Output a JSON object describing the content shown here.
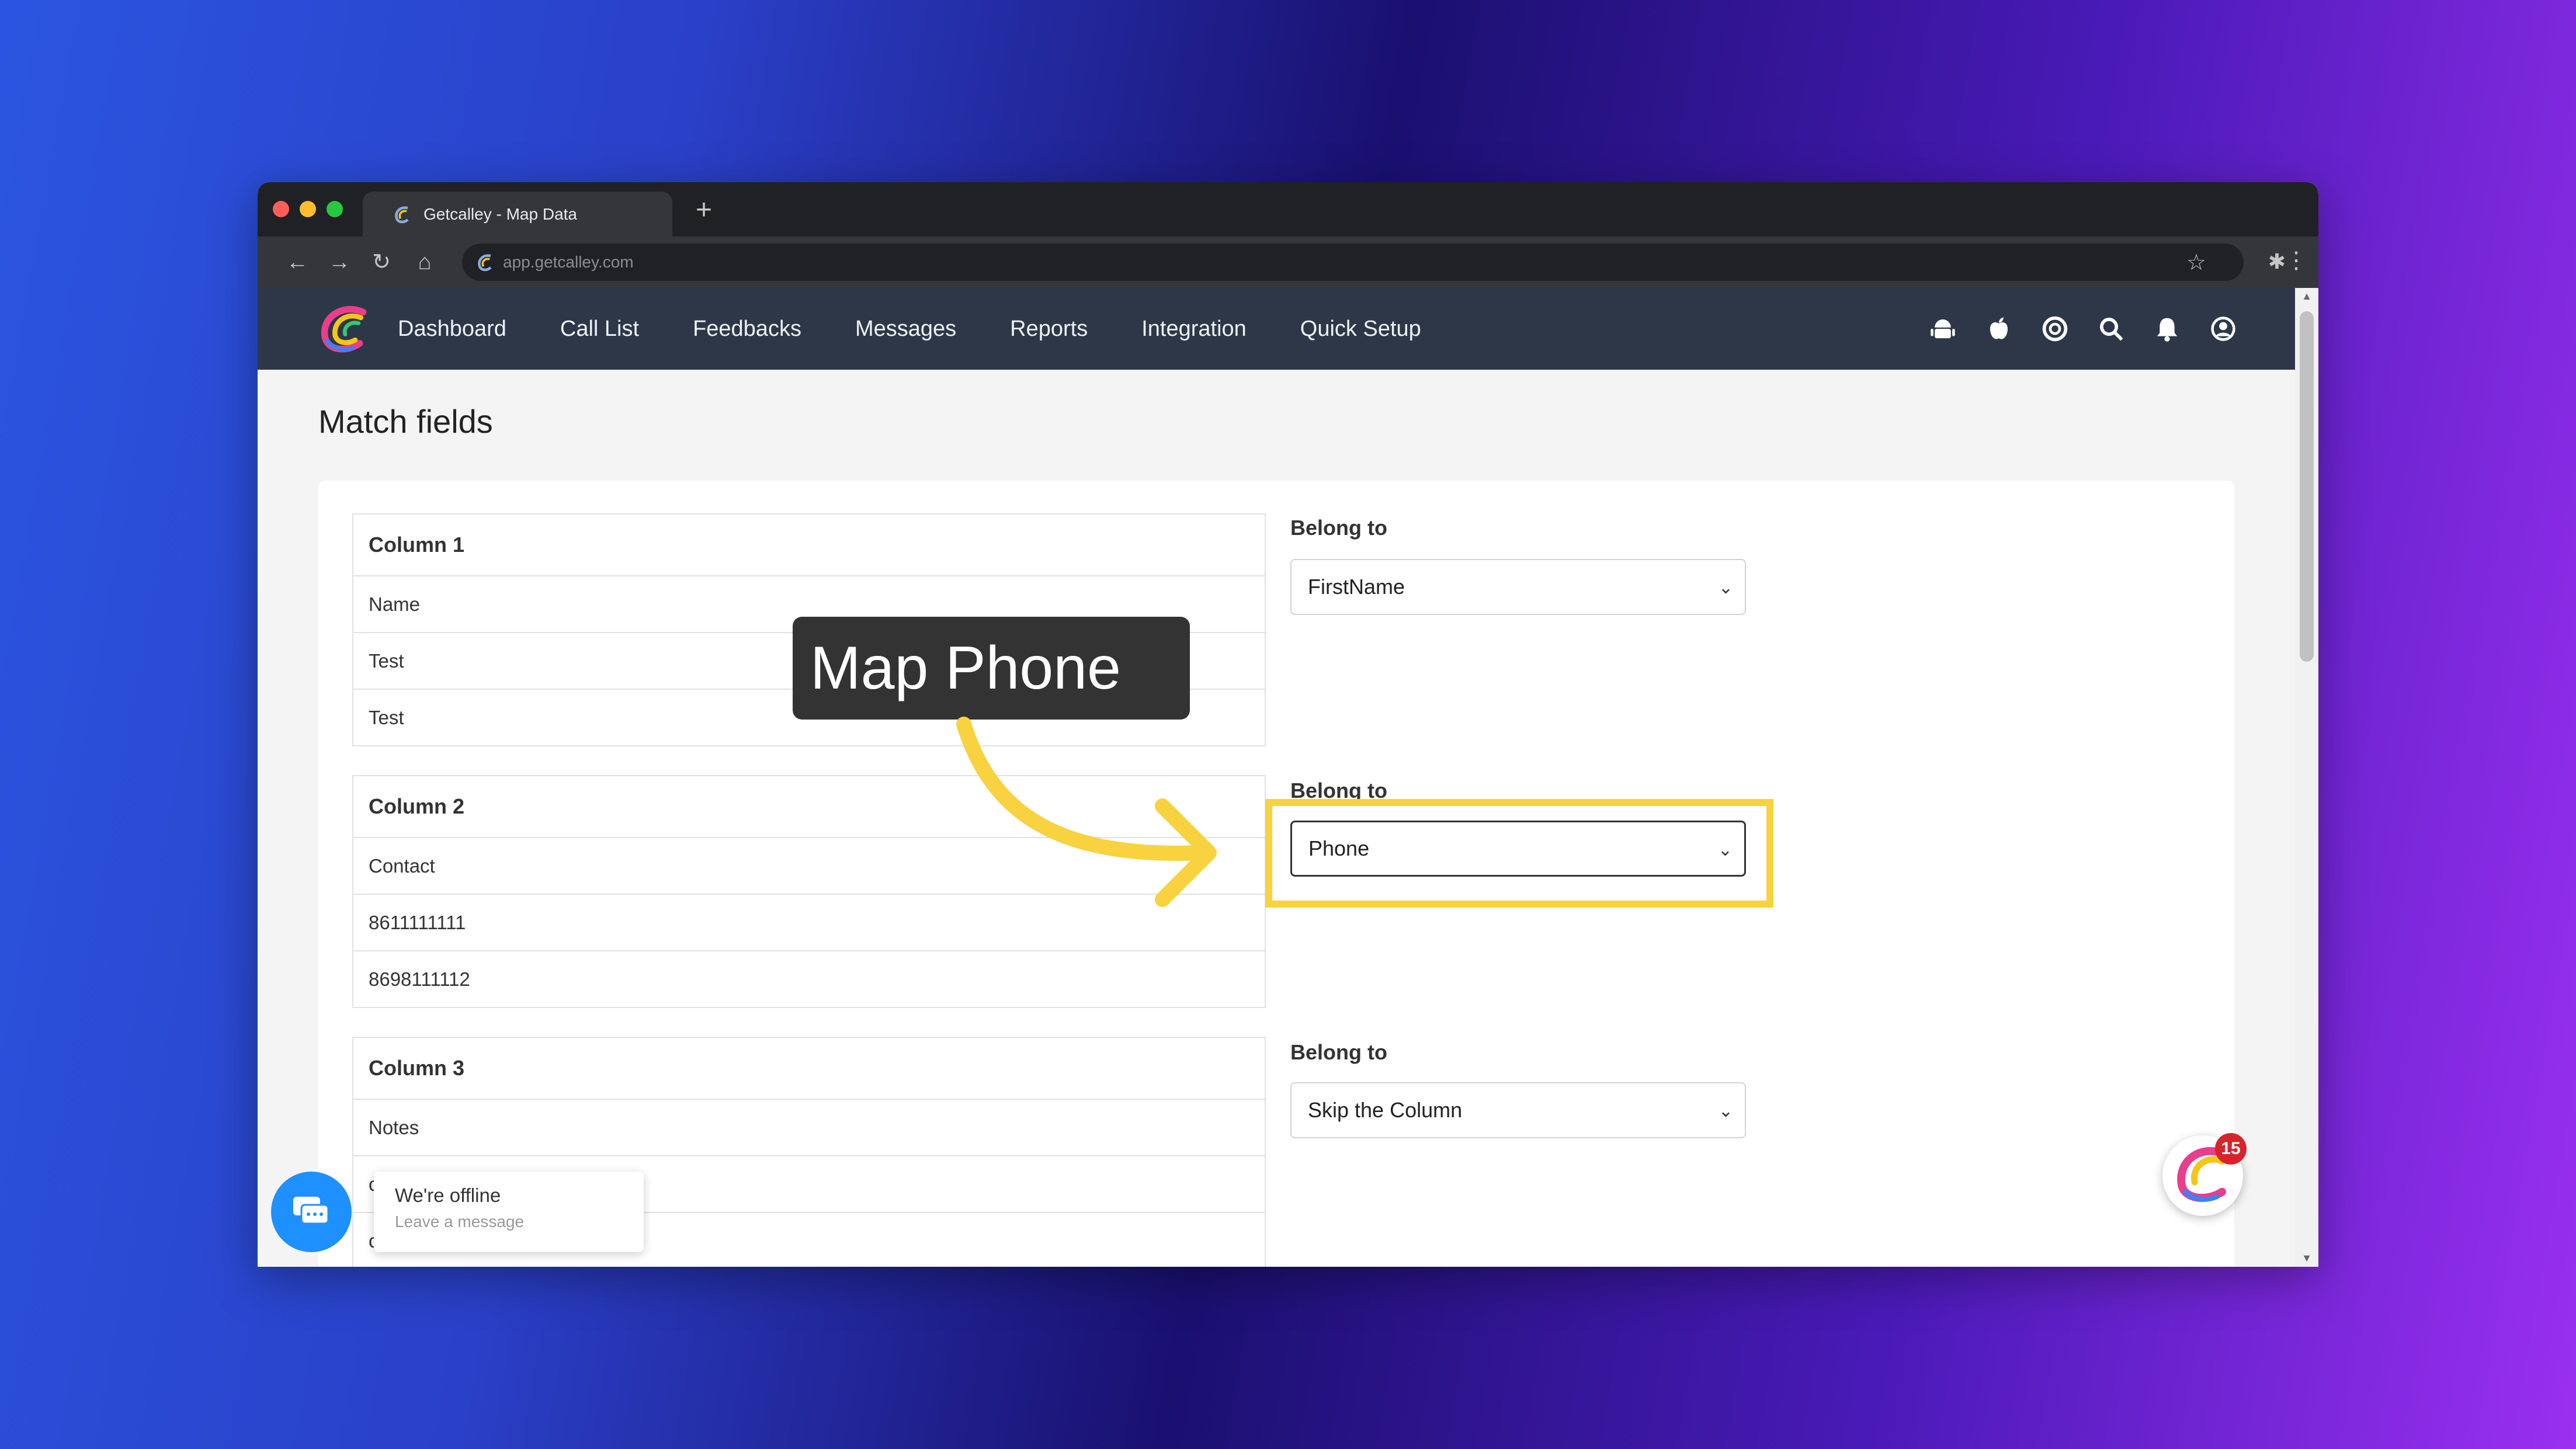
{
  "browser": {
    "tab_title": "Getcalley - Map Data",
    "new_tab": "+",
    "url": "app.getcalley.com"
  },
  "nav": {
    "items": [
      {
        "label": "Dashboard"
      },
      {
        "label": "Call List"
      },
      {
        "label": "Feedbacks"
      },
      {
        "label": "Messages"
      },
      {
        "label": "Reports"
      },
      {
        "label": "Integration"
      },
      {
        "label": "Quick Setup"
      }
    ]
  },
  "page": {
    "title": "Match fields"
  },
  "columns": [
    {
      "header": "Column 1",
      "rows": [
        "Name",
        "Test",
        "Test"
      ],
      "belong_label": "Belong to",
      "selected": "FirstName"
    },
    {
      "header": "Column 2",
      "rows": [
        "Contact",
        "8611111111",
        "8698111112"
      ],
      "belong_label": "Belong to",
      "selected": "Phone"
    },
    {
      "header": "Column 3",
      "rows": [
        "Notes",
        "c",
        "c"
      ],
      "belong_label": "Belong to",
      "selected": "Skip the Column"
    }
  ],
  "annotation": {
    "tooltip": "Map Phone",
    "highlight_color": "#f8d23f"
  },
  "chat": {
    "title": "We're offline",
    "subtitle": "Leave a message"
  },
  "float_badge": "15",
  "colors": {
    "nav_bg": "#2d3748",
    "chat_blue": "#1e90ff",
    "badge_red": "#d8232a"
  }
}
